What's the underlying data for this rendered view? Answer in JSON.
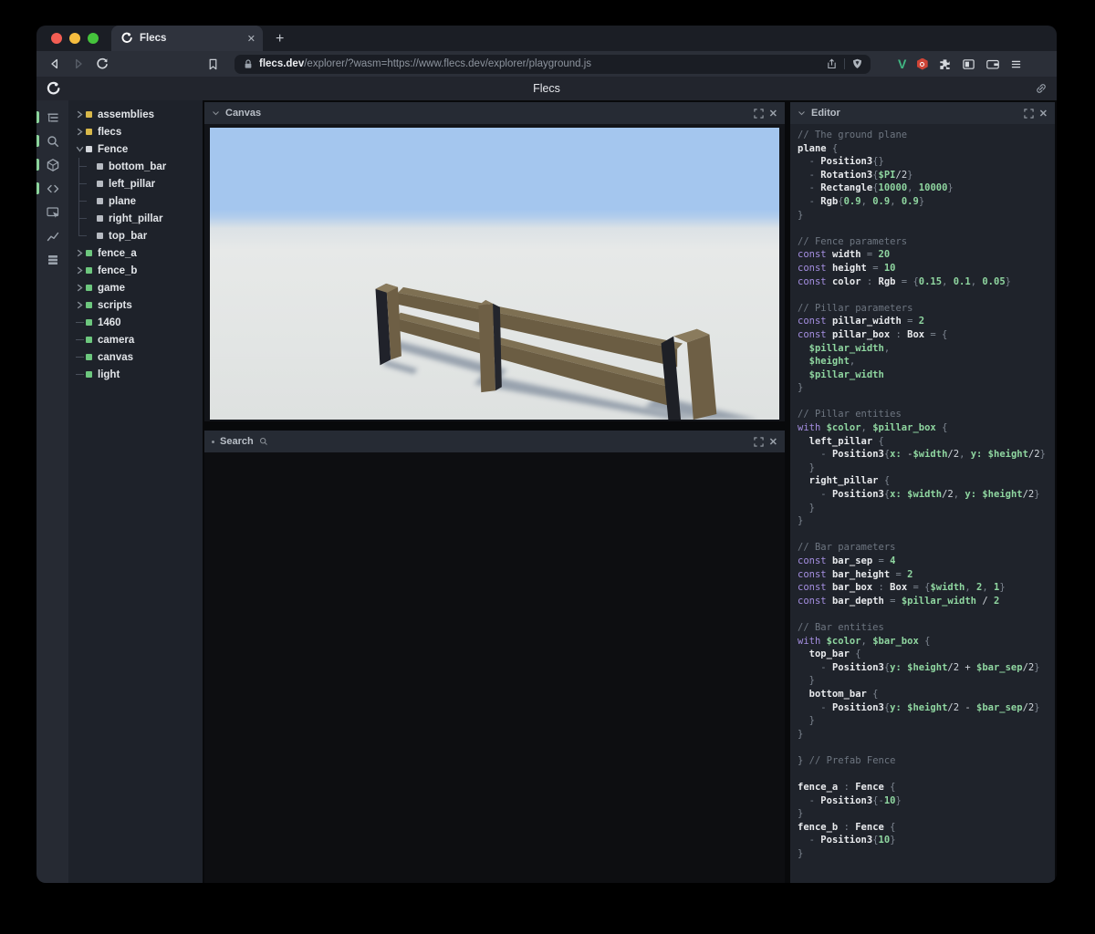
{
  "browser": {
    "tab": {
      "title": "Flecs",
      "close_label": "✕",
      "new_tab_label": "+"
    },
    "address": {
      "domain": "flecs.dev",
      "path": "/explorer/?wasm=https://www.flecs.dev/explorer/playground.js"
    },
    "toolbar_icons": [
      "back-icon",
      "forward-icon",
      "reload-icon",
      "bookmark-icon",
      "lock-icon",
      "share-icon",
      "brave-shield-icon",
      "vue-devtools-icon",
      "adblock-hexagon-icon",
      "extensions-puzzle-icon",
      "side-panel-icon",
      "wallet-icon",
      "menu-icon"
    ],
    "vue_letter": "V"
  },
  "app_header": {
    "title": "Flecs"
  },
  "sidebar": {
    "icons": [
      {
        "name": "outline-tree-icon",
        "active": true
      },
      {
        "name": "search-icon",
        "active": true
      },
      {
        "name": "cube-icon",
        "active": true
      },
      {
        "name": "code-icon",
        "active": true
      },
      {
        "name": "inspector-icon",
        "active": false
      },
      {
        "name": "chart-icon",
        "active": false
      },
      {
        "name": "layers-icon",
        "active": false
      }
    ]
  },
  "tree": {
    "items": [
      {
        "label": "assemblies",
        "marker": "collapsed",
        "color": "#d8b84a"
      },
      {
        "label": "flecs",
        "marker": "collapsed",
        "color": "#d8b84a"
      },
      {
        "label": "Fence",
        "marker": "expanded",
        "color": "#d3d6db"
      },
      {
        "label": "bottom_bar",
        "marker": "child",
        "color": "#b7bbc2"
      },
      {
        "label": "left_pillar",
        "marker": "child",
        "color": "#b7bbc2"
      },
      {
        "label": "plane",
        "marker": "child",
        "color": "#b7bbc2"
      },
      {
        "label": "right_pillar",
        "marker": "child",
        "color": "#b7bbc2"
      },
      {
        "label": "top_bar",
        "marker": "child",
        "color": "#b7bbc2",
        "last": true
      },
      {
        "label": "fence_a",
        "marker": "collapsed",
        "color": "#6dc77e"
      },
      {
        "label": "fence_b",
        "marker": "collapsed",
        "color": "#6dc77e"
      },
      {
        "label": "game",
        "marker": "collapsed",
        "color": "#6dc77e"
      },
      {
        "label": "scripts",
        "marker": "collapsed",
        "color": "#6dc77e"
      },
      {
        "label": "1460",
        "marker": "leaf",
        "color": "#6dc77e"
      },
      {
        "label": "camera",
        "marker": "leaf",
        "color": "#6dc77e"
      },
      {
        "label": "canvas",
        "marker": "leaf",
        "color": "#6dc77e"
      },
      {
        "label": "light",
        "marker": "leaf",
        "color": "#6dc77e"
      }
    ]
  },
  "panels": {
    "canvas": {
      "title": "Canvas"
    },
    "search": {
      "title": "Search"
    },
    "editor": {
      "title": "Editor"
    }
  },
  "editor": {
    "code_lines": [
      [
        [
          "c",
          "// The ground plane"
        ]
      ],
      [
        [
          "w",
          "plane"
        ],
        [
          "p",
          " {"
        ]
      ],
      [
        [
          "p",
          "  - "
        ],
        [
          "w",
          "Position3"
        ],
        [
          "p",
          "{}"
        ]
      ],
      [
        [
          "p",
          "  - "
        ],
        [
          "w",
          "Rotation3"
        ],
        [
          "p",
          "{"
        ],
        [
          "g",
          "$PI"
        ],
        [
          "t",
          "/2"
        ],
        [
          "p",
          "}"
        ]
      ],
      [
        [
          "p",
          "  - "
        ],
        [
          "w",
          "Rectangle"
        ],
        [
          "p",
          "{"
        ],
        [
          "g",
          "10000"
        ],
        [
          "p",
          ", "
        ],
        [
          "g",
          "10000"
        ],
        [
          "p",
          "}"
        ]
      ],
      [
        [
          "p",
          "  - "
        ],
        [
          "w",
          "Rgb"
        ],
        [
          "p",
          "{"
        ],
        [
          "g",
          "0.9"
        ],
        [
          "p",
          ", "
        ],
        [
          "g",
          "0.9"
        ],
        [
          "p",
          ", "
        ],
        [
          "g",
          "0.9"
        ],
        [
          "p",
          "}"
        ]
      ],
      [
        [
          "p",
          "}"
        ]
      ],
      [],
      [
        [
          "c",
          "// Fence parameters"
        ]
      ],
      [
        [
          "k",
          "const "
        ],
        [
          "w",
          "width"
        ],
        [
          "p",
          " = "
        ],
        [
          "g",
          "20"
        ]
      ],
      [
        [
          "k",
          "const "
        ],
        [
          "w",
          "height"
        ],
        [
          "p",
          " = "
        ],
        [
          "g",
          "10"
        ]
      ],
      [
        [
          "k",
          "const "
        ],
        [
          "w",
          "color"
        ],
        [
          "p",
          " : "
        ],
        [
          "w",
          "Rgb"
        ],
        [
          "p",
          " = {"
        ],
        [
          "g",
          "0.15"
        ],
        [
          "p",
          ", "
        ],
        [
          "g",
          "0.1"
        ],
        [
          "p",
          ", "
        ],
        [
          "g",
          "0.05"
        ],
        [
          "p",
          "}"
        ]
      ],
      [],
      [
        [
          "c",
          "// Pillar parameters"
        ]
      ],
      [
        [
          "k",
          "const "
        ],
        [
          "w",
          "pillar_width"
        ],
        [
          "p",
          " = "
        ],
        [
          "g",
          "2"
        ]
      ],
      [
        [
          "k",
          "const "
        ],
        [
          "w",
          "pillar_box"
        ],
        [
          "p",
          " : "
        ],
        [
          "w",
          "Box"
        ],
        [
          "p",
          " = {"
        ]
      ],
      [
        [
          "g",
          "  $pillar_width"
        ],
        [
          "p",
          ","
        ]
      ],
      [
        [
          "g",
          "  $height"
        ],
        [
          "p",
          ","
        ]
      ],
      [
        [
          "g",
          "  $pillar_width"
        ]
      ],
      [
        [
          "p",
          "}"
        ]
      ],
      [],
      [
        [
          "c",
          "// Pillar entities"
        ]
      ],
      [
        [
          "k",
          "with "
        ],
        [
          "g",
          "$color"
        ],
        [
          "p",
          ", "
        ],
        [
          "g",
          "$pillar_box"
        ],
        [
          "p",
          " {"
        ]
      ],
      [
        [
          "w",
          "  left_pillar"
        ],
        [
          "p",
          " {"
        ]
      ],
      [
        [
          "p",
          "    - "
        ],
        [
          "w",
          "Position3"
        ],
        [
          "p",
          "{"
        ],
        [
          "g",
          "x: "
        ],
        [
          "t",
          "-"
        ],
        [
          "g",
          "$width"
        ],
        [
          "t",
          "/2"
        ],
        [
          "p",
          ", "
        ],
        [
          "g",
          "y: $height"
        ],
        [
          "t",
          "/2"
        ],
        [
          "p",
          "}"
        ]
      ],
      [
        [
          "p",
          "  }"
        ]
      ],
      [
        [
          "w",
          "  right_pillar"
        ],
        [
          "p",
          " {"
        ]
      ],
      [
        [
          "p",
          "    - "
        ],
        [
          "w",
          "Position3"
        ],
        [
          "p",
          "{"
        ],
        [
          "g",
          "x: $width"
        ],
        [
          "t",
          "/2"
        ],
        [
          "p",
          ", "
        ],
        [
          "g",
          "y: $height"
        ],
        [
          "t",
          "/2"
        ],
        [
          "p",
          "}"
        ]
      ],
      [
        [
          "p",
          "  }"
        ]
      ],
      [
        [
          "p",
          "}"
        ]
      ],
      [],
      [
        [
          "c",
          "// Bar parameters"
        ]
      ],
      [
        [
          "k",
          "const "
        ],
        [
          "w",
          "bar_sep"
        ],
        [
          "p",
          " = "
        ],
        [
          "g",
          "4"
        ]
      ],
      [
        [
          "k",
          "const "
        ],
        [
          "w",
          "bar_height"
        ],
        [
          "p",
          " = "
        ],
        [
          "g",
          "2"
        ]
      ],
      [
        [
          "k",
          "const "
        ],
        [
          "w",
          "bar_box"
        ],
        [
          "p",
          " : "
        ],
        [
          "w",
          "Box"
        ],
        [
          "p",
          " = {"
        ],
        [
          "g",
          "$width"
        ],
        [
          "p",
          ", "
        ],
        [
          "g",
          "2"
        ],
        [
          "p",
          ", "
        ],
        [
          "g",
          "1"
        ],
        [
          "p",
          "}"
        ]
      ],
      [
        [
          "k",
          "const "
        ],
        [
          "w",
          "bar_depth"
        ],
        [
          "p",
          " = "
        ],
        [
          "g",
          "$pillar_width"
        ],
        [
          "t",
          " / "
        ],
        [
          "g",
          "2"
        ]
      ],
      [],
      [
        [
          "c",
          "// Bar entities"
        ]
      ],
      [
        [
          "k",
          "with "
        ],
        [
          "g",
          "$color"
        ],
        [
          "p",
          ", "
        ],
        [
          "g",
          "$bar_box"
        ],
        [
          "p",
          " {"
        ]
      ],
      [
        [
          "w",
          "  top_bar"
        ],
        [
          "p",
          " {"
        ]
      ],
      [
        [
          "p",
          "    - "
        ],
        [
          "w",
          "Position3"
        ],
        [
          "p",
          "{"
        ],
        [
          "g",
          "y: $height"
        ],
        [
          "t",
          "/2 + "
        ],
        [
          "g",
          "$bar_sep"
        ],
        [
          "t",
          "/2"
        ],
        [
          "p",
          "}"
        ]
      ],
      [
        [
          "p",
          "  }"
        ]
      ],
      [
        [
          "w",
          "  bottom_bar"
        ],
        [
          "p",
          " {"
        ]
      ],
      [
        [
          "p",
          "    - "
        ],
        [
          "w",
          "Position3"
        ],
        [
          "p",
          "{"
        ],
        [
          "g",
          "y: $height"
        ],
        [
          "t",
          "/2 - "
        ],
        [
          "g",
          "$bar_sep"
        ],
        [
          "t",
          "/2"
        ],
        [
          "p",
          "}"
        ]
      ],
      [
        [
          "p",
          "  }"
        ]
      ],
      [
        [
          "p",
          "}"
        ]
      ],
      [],
      [
        [
          "p",
          "} "
        ],
        [
          "c",
          "// Prefab Fence"
        ]
      ],
      [],
      [
        [
          "w",
          "fence_a"
        ],
        [
          "p",
          " : "
        ],
        [
          "w",
          "Fence"
        ],
        [
          "p",
          " {"
        ]
      ],
      [
        [
          "p",
          "  - "
        ],
        [
          "w",
          "Position3"
        ],
        [
          "p",
          "{-"
        ],
        [
          "g",
          "10"
        ],
        [
          "p",
          "}"
        ]
      ],
      [
        [
          "p",
          "}"
        ]
      ],
      [
        [
          "w",
          "fence_b"
        ],
        [
          "p",
          " : "
        ],
        [
          "w",
          "Fence"
        ],
        [
          "p",
          " {"
        ]
      ],
      [
        [
          "p",
          "  - "
        ],
        [
          "w",
          "Position3"
        ],
        [
          "p",
          "{"
        ],
        [
          "g",
          "10"
        ],
        [
          "p",
          "}"
        ]
      ],
      [
        [
          "p",
          "}"
        ]
      ]
    ]
  },
  "colors": {
    "accent_green": "#8bd39b",
    "tree_yellow": "#d8b84a",
    "tree_green": "#6dc77e",
    "sky": "#a4c6ee",
    "ground": "#e3e6e5",
    "wood_front": "#6b5d43",
    "wood_top": "#7e7053",
    "wood_dark": "#20222a"
  }
}
